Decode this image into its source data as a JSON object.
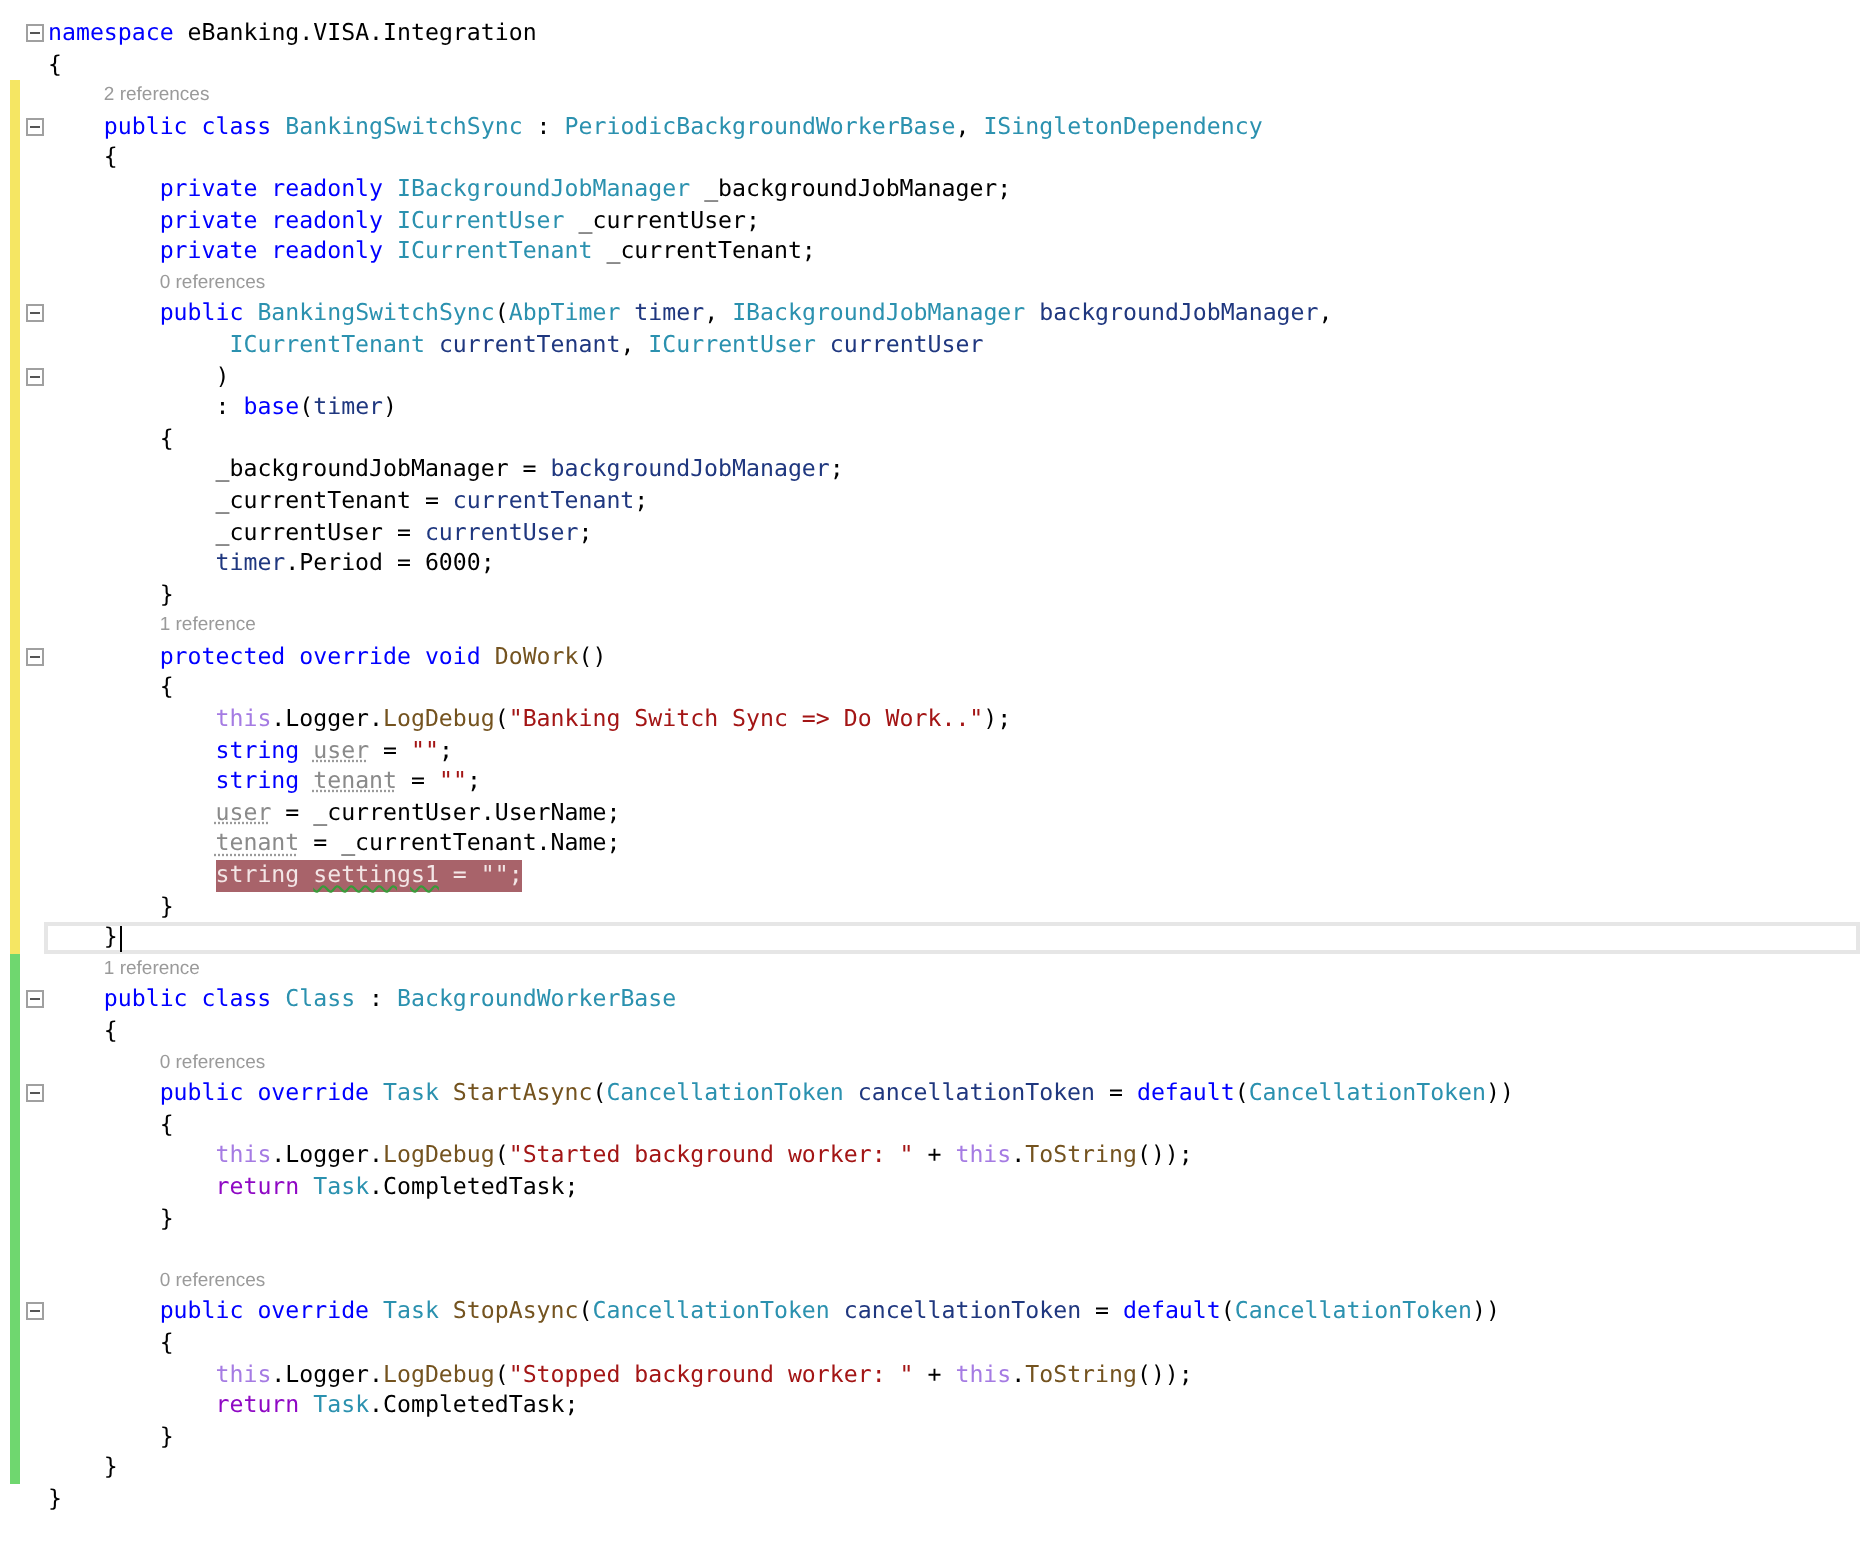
{
  "lines": [
    {
      "unsaved_change": false,
      "saved_change": false,
      "fold": true,
      "highlighted": false,
      "current": false,
      "tokens": [
        {
          "kind": "keyword",
          "text": "namespace"
        },
        {
          "kind": "plain",
          "text": " eBanking.VISA.Integration"
        }
      ]
    },
    {
      "unsaved_change": false,
      "saved_change": false,
      "fold": false,
      "highlighted": false,
      "current": false,
      "tokens": [
        {
          "kind": "plain",
          "text": "{"
        }
      ]
    },
    {
      "unsaved_change": true,
      "saved_change": false,
      "fold": true,
      "highlighted": false,
      "current": false,
      "references": "2 references",
      "tokens": [
        {
          "kind": "keyword",
          "text": "    public class "
        },
        {
          "kind": "type",
          "text": "BankingSwitchSync"
        },
        {
          "kind": "plain",
          "text": " : "
        },
        {
          "kind": "type",
          "text": "PeriodicBackgroundWorkerBase"
        },
        {
          "kind": "plain",
          "text": ", "
        },
        {
          "kind": "type",
          "text": "ISingletonDependency"
        }
      ]
    },
    {
      "unsaved_change": true,
      "saved_change": false,
      "fold": false,
      "highlighted": false,
      "current": false,
      "tokens": [
        {
          "kind": "plain",
          "text": "    {"
        }
      ]
    },
    {
      "unsaved_change": true,
      "saved_change": false,
      "fold": false,
      "highlighted": false,
      "current": false,
      "tokens": [
        {
          "kind": "keyword",
          "text": "        private readonly "
        },
        {
          "kind": "type",
          "text": "IBackgroundJobManager"
        },
        {
          "kind": "plain",
          "text": " _backgroundJobManager;"
        }
      ]
    },
    {
      "unsaved_change": true,
      "saved_change": false,
      "fold": false,
      "highlighted": false,
      "current": false,
      "tokens": [
        {
          "kind": "keyword",
          "text": "        private readonly "
        },
        {
          "kind": "type",
          "text": "ICurrentUser"
        },
        {
          "kind": "plain",
          "text": " _currentUser;"
        }
      ]
    },
    {
      "unsaved_change": true,
      "saved_change": false,
      "fold": false,
      "highlighted": false,
      "current": false,
      "tokens": [
        {
          "kind": "keyword",
          "text": "        private readonly "
        },
        {
          "kind": "type",
          "text": "ICurrentTenant"
        },
        {
          "kind": "plain",
          "text": " _currentTenant;"
        }
      ]
    },
    {
      "unsaved_change": true,
      "saved_change": false,
      "fold": true,
      "highlighted": false,
      "current": false,
      "references": "0 references",
      "tokens": [
        {
          "kind": "keyword",
          "text": "        public "
        },
        {
          "kind": "type",
          "text": "BankingSwitchSync"
        },
        {
          "kind": "plain",
          "text": "("
        },
        {
          "kind": "type",
          "text": "AbpTimer"
        },
        {
          "kind": "param",
          "text": " timer"
        },
        {
          "kind": "plain",
          "text": ", "
        },
        {
          "kind": "type",
          "text": "IBackgroundJobManager"
        },
        {
          "kind": "param",
          "text": " backgroundJobManager"
        },
        {
          "kind": "plain",
          "text": ","
        }
      ]
    },
    {
      "unsaved_change": true,
      "saved_change": false,
      "fold": false,
      "highlighted": false,
      "current": false,
      "tokens": [
        {
          "kind": "type",
          "text": "             ICurrentTenant"
        },
        {
          "kind": "param",
          "text": " currentTenant"
        },
        {
          "kind": "plain",
          "text": ", "
        },
        {
          "kind": "type",
          "text": "ICurrentUser"
        },
        {
          "kind": "param",
          "text": " currentUser"
        }
      ]
    },
    {
      "unsaved_change": true,
      "saved_change": false,
      "fold": true,
      "highlighted": false,
      "current": false,
      "tokens": [
        {
          "kind": "plain",
          "text": "            )"
        }
      ]
    },
    {
      "unsaved_change": true,
      "saved_change": false,
      "fold": false,
      "highlighted": false,
      "current": false,
      "tokens": [
        {
          "kind": "plain",
          "text": "            : "
        },
        {
          "kind": "keyword",
          "text": "base"
        },
        {
          "kind": "plain",
          "text": "("
        },
        {
          "kind": "param",
          "text": "timer"
        },
        {
          "kind": "plain",
          "text": ")"
        }
      ]
    },
    {
      "unsaved_change": true,
      "saved_change": false,
      "fold": false,
      "highlighted": false,
      "current": false,
      "tokens": [
        {
          "kind": "plain",
          "text": "        {"
        }
      ]
    },
    {
      "unsaved_change": true,
      "saved_change": false,
      "fold": false,
      "highlighted": false,
      "current": false,
      "tokens": [
        {
          "kind": "plain",
          "text": "            _backgroundJobManager = "
        },
        {
          "kind": "param",
          "text": "backgroundJobManager"
        },
        {
          "kind": "plain",
          "text": ";"
        }
      ]
    },
    {
      "unsaved_change": true,
      "saved_change": false,
      "fold": false,
      "highlighted": false,
      "current": false,
      "tokens": [
        {
          "kind": "plain",
          "text": "            _currentTenant = "
        },
        {
          "kind": "param",
          "text": "currentTenant"
        },
        {
          "kind": "plain",
          "text": ";"
        }
      ]
    },
    {
      "unsaved_change": true,
      "saved_change": false,
      "fold": false,
      "highlighted": false,
      "current": false,
      "tokens": [
        {
          "kind": "plain",
          "text": "            _currentUser = "
        },
        {
          "kind": "param",
          "text": "currentUser"
        },
        {
          "kind": "plain",
          "text": ";"
        }
      ]
    },
    {
      "unsaved_change": true,
      "saved_change": false,
      "fold": false,
      "highlighted": false,
      "current": false,
      "tokens": [
        {
          "kind": "param",
          "text": "            timer"
        },
        {
          "kind": "plain",
          "text": ".Period = 6000;"
        }
      ]
    },
    {
      "unsaved_change": true,
      "saved_change": false,
      "fold": false,
      "highlighted": false,
      "current": false,
      "tokens": [
        {
          "kind": "plain",
          "text": "        }"
        }
      ]
    },
    {
      "unsaved_change": true,
      "saved_change": false,
      "fold": true,
      "highlighted": false,
      "current": false,
      "references": "1 reference",
      "tokens": [
        {
          "kind": "keyword",
          "text": "        protected override void "
        },
        {
          "kind": "method",
          "text": "DoWork"
        },
        {
          "kind": "plain",
          "text": "()"
        }
      ]
    },
    {
      "unsaved_change": true,
      "saved_change": false,
      "fold": false,
      "highlighted": false,
      "current": false,
      "tokens": [
        {
          "kind": "plain",
          "text": "        {"
        }
      ]
    },
    {
      "unsaved_change": true,
      "saved_change": false,
      "fold": false,
      "highlighted": false,
      "current": false,
      "tokens": [
        {
          "kind": "this",
          "text": "            this"
        },
        {
          "kind": "plain",
          "text": ".Logger."
        },
        {
          "kind": "method",
          "text": "LogDebug"
        },
        {
          "kind": "plain",
          "text": "("
        },
        {
          "kind": "string",
          "text": "\"Banking Switch Sync => Do Work..\""
        },
        {
          "kind": "plain",
          "text": ");"
        }
      ]
    },
    {
      "unsaved_change": true,
      "saved_change": false,
      "fold": false,
      "highlighted": false,
      "current": false,
      "tokens": [
        {
          "kind": "keyword",
          "text": "            string "
        },
        {
          "kind": "unused",
          "text": "user"
        },
        {
          "kind": "plain",
          "text": " = "
        },
        {
          "kind": "string",
          "text": "\"\""
        },
        {
          "kind": "plain",
          "text": ";"
        }
      ]
    },
    {
      "unsaved_change": true,
      "saved_change": false,
      "fold": false,
      "highlighted": false,
      "current": false,
      "tokens": [
        {
          "kind": "keyword",
          "text": "            string "
        },
        {
          "kind": "unused",
          "text": "tenant"
        },
        {
          "kind": "plain",
          "text": " = "
        },
        {
          "kind": "string",
          "text": "\"\""
        },
        {
          "kind": "plain",
          "text": ";"
        }
      ]
    },
    {
      "unsaved_change": true,
      "saved_change": false,
      "fold": false,
      "highlighted": false,
      "current": false,
      "tokens": [
        {
          "kind": "unused",
          "text": "            user"
        },
        {
          "kind": "plain",
          "text": " = _currentUser.UserName;"
        }
      ]
    },
    {
      "unsaved_change": true,
      "saved_change": false,
      "fold": false,
      "highlighted": false,
      "current": false,
      "tokens": [
        {
          "kind": "unused",
          "text": "            tenant"
        },
        {
          "kind": "plain",
          "text": " = _currentTenant.Name;"
        }
      ]
    },
    {
      "unsaved_change": true,
      "saved_change": false,
      "fold": false,
      "highlighted": true,
      "current": false,
      "tokens": [
        {
          "kind": "keyword",
          "text": "            string "
        },
        {
          "kind": "warning",
          "text": "settings1"
        },
        {
          "kind": "plain",
          "text": " = "
        },
        {
          "kind": "string",
          "text": "\"\""
        },
        {
          "kind": "plain",
          "text": ";"
        }
      ]
    },
    {
      "unsaved_change": true,
      "saved_change": false,
      "fold": false,
      "highlighted": false,
      "current": false,
      "tokens": [
        {
          "kind": "plain",
          "text": "        }"
        }
      ]
    },
    {
      "unsaved_change": true,
      "saved_change": false,
      "fold": false,
      "highlighted": false,
      "current": true,
      "tokens": [
        {
          "kind": "plain",
          "text": "    }"
        }
      ]
    },
    {
      "unsaved_change": false,
      "saved_change": true,
      "fold": true,
      "highlighted": false,
      "current": false,
      "references": "1 reference",
      "tokens": [
        {
          "kind": "keyword",
          "text": "    public class "
        },
        {
          "kind": "type",
          "text": "Class"
        },
        {
          "kind": "plain",
          "text": " : "
        },
        {
          "kind": "type",
          "text": "BackgroundWorkerBase"
        }
      ]
    },
    {
      "unsaved_change": false,
      "saved_change": true,
      "fold": false,
      "highlighted": false,
      "current": false,
      "tokens": [
        {
          "kind": "plain",
          "text": "    {"
        }
      ]
    },
    {
      "unsaved_change": false,
      "saved_change": true,
      "fold": true,
      "highlighted": false,
      "current": false,
      "references": "0 references",
      "tokens": [
        {
          "kind": "keyword",
          "text": "        public override "
        },
        {
          "kind": "type",
          "text": "Task"
        },
        {
          "kind": "method",
          "text": " StartAsync"
        },
        {
          "kind": "plain",
          "text": "("
        },
        {
          "kind": "type",
          "text": "CancellationToken"
        },
        {
          "kind": "param",
          "text": " cancellationToken"
        },
        {
          "kind": "plain",
          "text": " = "
        },
        {
          "kind": "keyword",
          "text": "default"
        },
        {
          "kind": "plain",
          "text": "("
        },
        {
          "kind": "type",
          "text": "CancellationToken"
        },
        {
          "kind": "plain",
          "text": "))"
        }
      ]
    },
    {
      "unsaved_change": false,
      "saved_change": true,
      "fold": false,
      "highlighted": false,
      "current": false,
      "tokens": [
        {
          "kind": "plain",
          "text": "        {"
        }
      ]
    },
    {
      "unsaved_change": false,
      "saved_change": true,
      "fold": false,
      "highlighted": false,
      "current": false,
      "tokens": [
        {
          "kind": "this",
          "text": "            this"
        },
        {
          "kind": "plain",
          "text": ".Logger."
        },
        {
          "kind": "method",
          "text": "LogDebug"
        },
        {
          "kind": "plain",
          "text": "("
        },
        {
          "kind": "string",
          "text": "\"Started background worker: \""
        },
        {
          "kind": "plain",
          "text": " + "
        },
        {
          "kind": "this",
          "text": "this"
        },
        {
          "kind": "plain",
          "text": "."
        },
        {
          "kind": "method",
          "text": "ToString"
        },
        {
          "kind": "plain",
          "text": "());"
        }
      ]
    },
    {
      "unsaved_change": false,
      "saved_change": true,
      "fold": false,
      "highlighted": false,
      "current": false,
      "tokens": [
        {
          "kind": "control",
          "text": "            return "
        },
        {
          "kind": "type",
          "text": "Task"
        },
        {
          "kind": "plain",
          "text": ".CompletedTask;"
        }
      ]
    },
    {
      "unsaved_change": false,
      "saved_change": true,
      "fold": false,
      "highlighted": false,
      "current": false,
      "tokens": [
        {
          "kind": "plain",
          "text": "        }"
        }
      ]
    },
    {
      "unsaved_change": false,
      "saved_change": true,
      "fold": false,
      "highlighted": false,
      "current": false
    },
    {
      "unsaved_change": false,
      "saved_change": true,
      "fold": true,
      "highlighted": false,
      "current": false,
      "references": "0 references",
      "tokens": [
        {
          "kind": "keyword",
          "text": "        public override "
        },
        {
          "kind": "type",
          "text": "Task"
        },
        {
          "kind": "method",
          "text": " StopAsync"
        },
        {
          "kind": "plain",
          "text": "("
        },
        {
          "kind": "type",
          "text": "CancellationToken"
        },
        {
          "kind": "param",
          "text": " cancellationToken"
        },
        {
          "kind": "plain",
          "text": " = "
        },
        {
          "kind": "keyword",
          "text": "default"
        },
        {
          "kind": "plain",
          "text": "("
        },
        {
          "kind": "type",
          "text": "CancellationToken"
        },
        {
          "kind": "plain",
          "text": "))"
        }
      ]
    },
    {
      "unsaved_change": false,
      "saved_change": true,
      "fold": false,
      "highlighted": false,
      "current": false,
      "tokens": [
        {
          "kind": "plain",
          "text": "        {"
        }
      ]
    },
    {
      "unsaved_change": false,
      "saved_change": true,
      "fold": false,
      "highlighted": false,
      "current": false,
      "tokens": [
        {
          "kind": "this",
          "text": "            this"
        },
        {
          "kind": "plain",
          "text": ".Logger."
        },
        {
          "kind": "method",
          "text": "LogDebug"
        },
        {
          "kind": "plain",
          "text": "("
        },
        {
          "kind": "string",
          "text": "\"Stopped background worker: \""
        },
        {
          "kind": "plain",
          "text": " + "
        },
        {
          "kind": "this",
          "text": "this"
        },
        {
          "kind": "plain",
          "text": "."
        },
        {
          "kind": "method",
          "text": "ToString"
        },
        {
          "kind": "plain",
          "text": "());"
        }
      ]
    },
    {
      "unsaved_change": false,
      "saved_change": true,
      "fold": false,
      "highlighted": false,
      "current": false,
      "tokens": [
        {
          "kind": "control",
          "text": "            return "
        },
        {
          "kind": "type",
          "text": "Task"
        },
        {
          "kind": "plain",
          "text": ".CompletedTask;"
        }
      ]
    },
    {
      "unsaved_change": false,
      "saved_change": true,
      "fold": false,
      "highlighted": false,
      "current": false,
      "tokens": [
        {
          "kind": "plain",
          "text": "        }"
        }
      ]
    },
    {
      "unsaved_change": false,
      "saved_change": true,
      "fold": false,
      "highlighted": false,
      "current": false,
      "tokens": [
        {
          "kind": "plain",
          "text": "    }"
        }
      ]
    },
    {
      "unsaved_change": false,
      "saved_change": false,
      "fold": false,
      "highlighted": false,
      "current": false,
      "tokens": [
        {
          "kind": "plain",
          "text": "}"
        }
      ]
    }
  ]
}
